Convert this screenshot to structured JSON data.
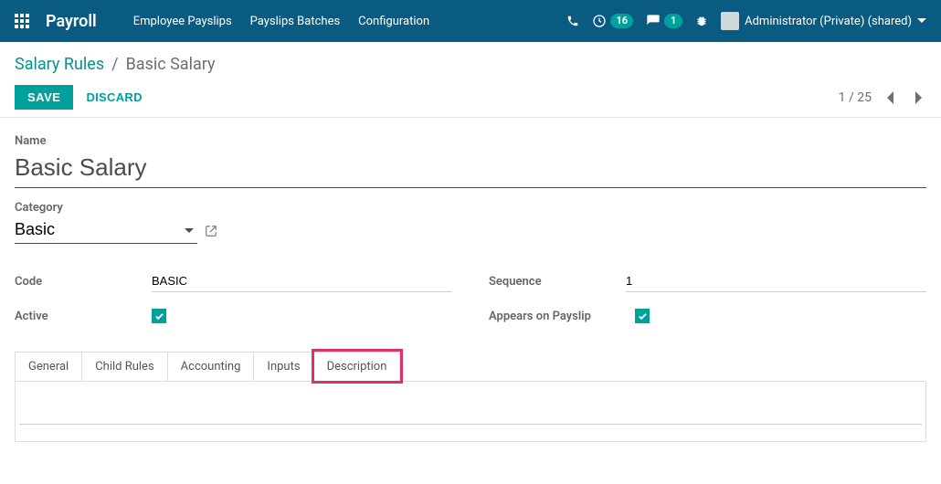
{
  "header": {
    "app_name": "Payroll",
    "nav": [
      "Employee Payslips",
      "Payslips Batches",
      "Configuration"
    ],
    "activity_count": "16",
    "msg_count": "1",
    "user_label": "Administrator (Private) (shared)"
  },
  "breadcrumb": {
    "root": "Salary Rules",
    "current": "Basic Salary"
  },
  "actions": {
    "save": "SAVE",
    "discard": "DISCARD"
  },
  "pager": {
    "text": "1 / 25"
  },
  "form": {
    "name_label": "Name",
    "name_value": "Basic Salary",
    "category_label": "Category",
    "category_value": "Basic",
    "code_label": "Code",
    "code_value": "BASIC",
    "active_label": "Active",
    "sequence_label": "Sequence",
    "sequence_value": "1",
    "appears_label": "Appears on Payslip"
  },
  "tabs": [
    "General",
    "Child Rules",
    "Accounting",
    "Inputs",
    "Description"
  ],
  "description_value": ""
}
